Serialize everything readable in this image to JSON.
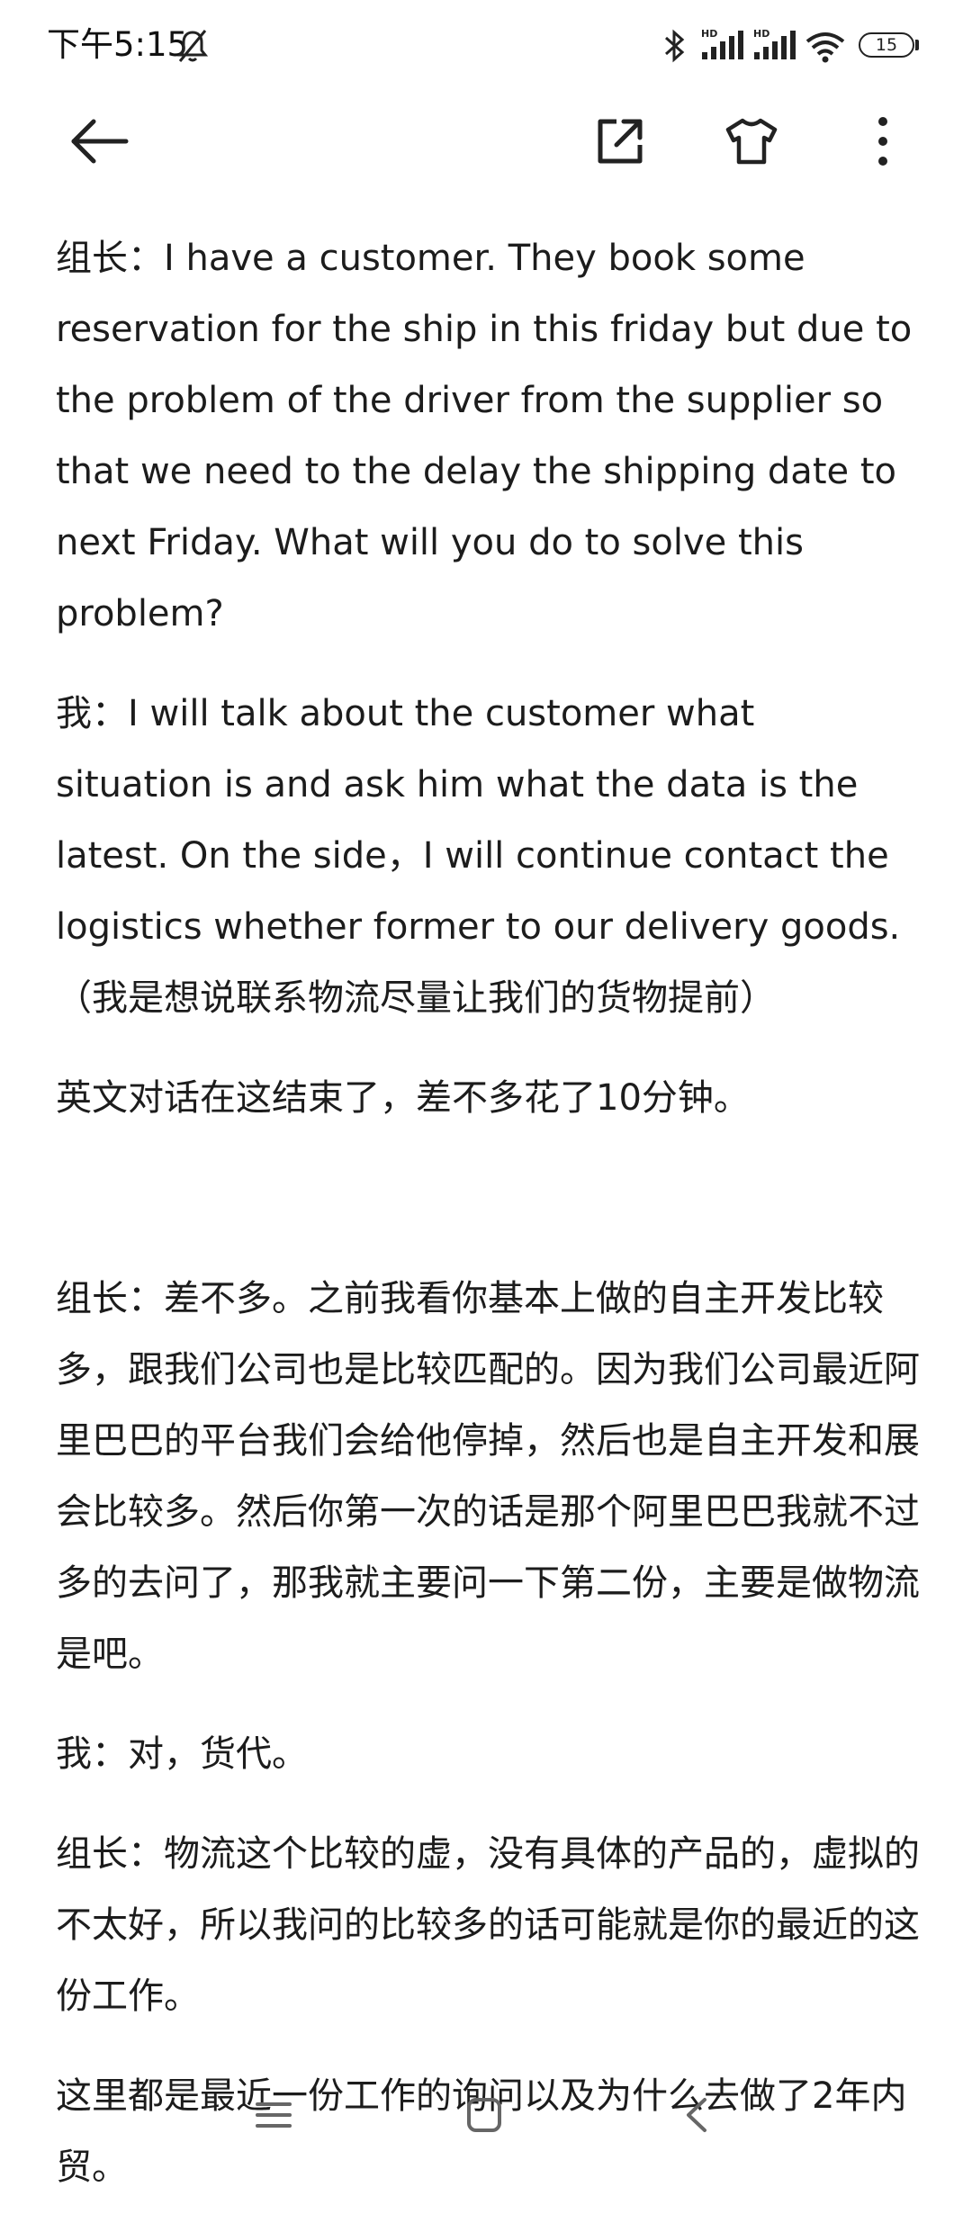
{
  "status_bar": {
    "time": "下午5:15",
    "battery": "15",
    "icons": [
      "mute-icon",
      "bluetooth-icon",
      "hd-signal-icon",
      "hd-signal-icon",
      "wifi-icon",
      "battery-icon"
    ]
  },
  "toolbar": {
    "icons": [
      "back-arrow-icon",
      "share-icon",
      "tshirt-icon",
      "more-vert-icon"
    ]
  },
  "content": {
    "paragraphs": [
      "组长：I have a customer. They book some reservation for the ship in this friday but due to the problem of the driver from the supplier so that we need to the delay the shipping date to next Friday. What will you do to solve this problem?",
      "我：I will talk about the customer what situation is and ask him what the data is the latest. On the side，I will continue contact the logistics whether former to our delivery goods.（我是想说联系物流尽量让我们的货物提前）",
      "英文对话在这结束了，差不多花了10分钟。",
      "组长：差不多。之前我看你基本上做的自主开发比较多，跟我们公司也是比较匹配的。因为我们公司最近阿里巴巴的平台我们会给他停掉，然后也是自主开发和展会比较多。然后你第一次的话是那个阿里巴巴我就不过多的去问了，那我就主要问一下第二份，主要是做物流是吧。",
      "我：对，货代。",
      "组长：物流这个比较的虚，没有具体的产品的，虚拟的不太好，所以我问的比较多的话可能就是你的最近的这份工作。",
      "这里都是最近一份工作的询问以及为什么去做了2年内贸。"
    ]
  },
  "nav_bar": {
    "icons": [
      "menu-icon",
      "home-icon",
      "back-icon"
    ]
  }
}
